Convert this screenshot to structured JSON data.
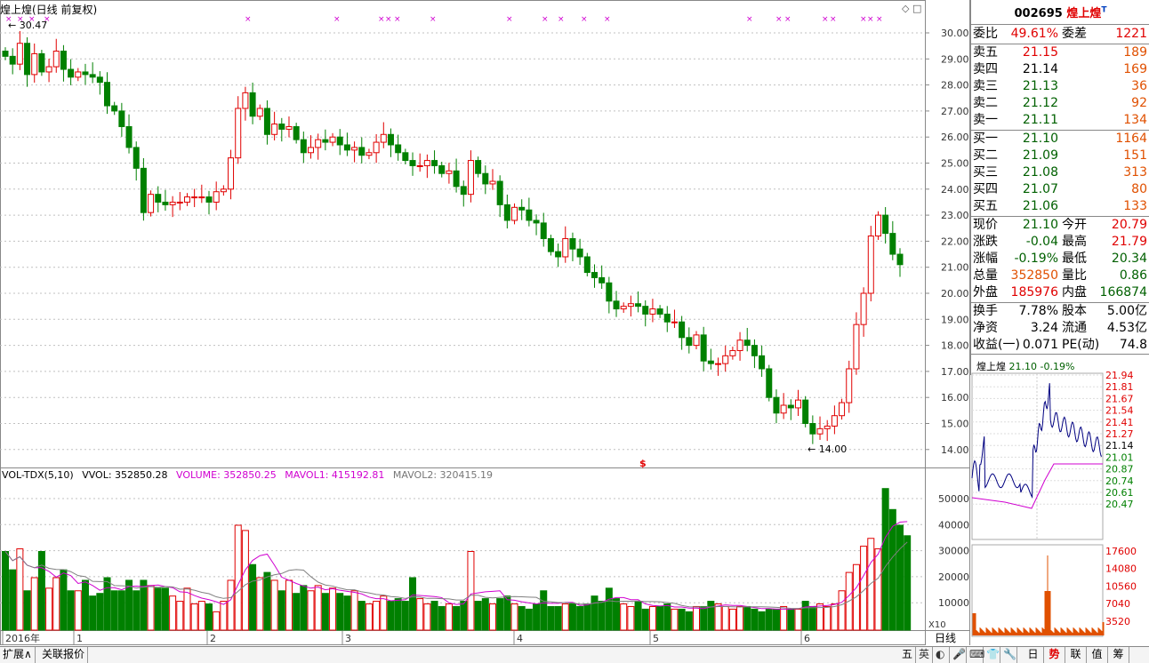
{
  "header": {
    "title": "煌上煌(日线 前复权)",
    "ctrl_icon": "◇",
    "close_icon": "□"
  },
  "price_chart": {
    "high_label": "30.47",
    "low_label": "14.00",
    "special_mark": "$",
    "xmarks": "×",
    "y_ticks": [
      "30.00",
      "29.00",
      "28.00",
      "27.00",
      "26.00",
      "25.00",
      "24.00",
      "23.00",
      "22.00",
      "21.00",
      "20.00",
      "19.00",
      "18.00",
      "17.00",
      "16.00",
      "15.00",
      "14.00"
    ]
  },
  "vol_chart": {
    "legend": {
      "name": "VOL-TDX(5,10)",
      "vvol": "VVOL: 352850.28",
      "volume": "VOLUME: 352850.25",
      "mavol1": "MAVOL1: 415192.81",
      "mavol2": "MAVOL2: 320415.19"
    },
    "y_ticks": [
      "50000",
      "40000",
      "30000",
      "20000",
      "10000"
    ],
    "unit": "X10"
  },
  "x_axis": {
    "labels": [
      "2016年",
      "1",
      "2",
      "3",
      "4",
      "5",
      "6"
    ]
  },
  "period_label": "日线",
  "bottom_buttons": [
    "扩展∧",
    "关联报价"
  ],
  "bottom_icons": [
    "五",
    "英",
    "◐",
    "🎤",
    "⌨",
    "👕",
    "🔧"
  ],
  "right_tabs": [
    "日",
    "势",
    "联",
    "值",
    "筹"
  ],
  "quote": {
    "code": "002695",
    "name": "煌上煌",
    "flag": "T",
    "weibi": {
      "label": "委比",
      "value": "49.61%",
      "label2": "委差",
      "value2": "1221"
    },
    "sell": [
      {
        "label": "卖五",
        "price": "21.15",
        "vol": "189"
      },
      {
        "label": "卖四",
        "price": "21.14",
        "vol": "169"
      },
      {
        "label": "卖三",
        "price": "21.13",
        "vol": "36"
      },
      {
        "label": "卖二",
        "price": "21.12",
        "vol": "92"
      },
      {
        "label": "卖一",
        "price": "21.11",
        "vol": "134"
      }
    ],
    "buy": [
      {
        "label": "买一",
        "price": "21.10",
        "vol": "1164"
      },
      {
        "label": "买二",
        "price": "21.09",
        "vol": "151"
      },
      {
        "label": "买三",
        "price": "21.08",
        "vol": "313"
      },
      {
        "label": "买四",
        "price": "21.07",
        "vol": "80"
      },
      {
        "label": "买五",
        "price": "21.06",
        "vol": "133"
      }
    ],
    "stats": [
      {
        "l1": "现价",
        "v1": "21.10",
        "l2": "今开",
        "v2": "20.79"
      },
      {
        "l1": "涨跌",
        "v1": "-0.04",
        "l2": "最高",
        "v2": "21.79"
      },
      {
        "l1": "涨幅",
        "v1": "-0.19%",
        "l2": "最低",
        "v2": "20.34"
      },
      {
        "l1": "总量",
        "v1": "352850",
        "l2": "量比",
        "v2": "0.86"
      },
      {
        "l1": "外盘",
        "v1": "185976",
        "l2": "内盘",
        "v2": "166874"
      }
    ],
    "stats2": [
      {
        "l1": "换手",
        "v1": "7.78%",
        "l2": "股本",
        "v2": "5.00亿"
      },
      {
        "l1": "净资",
        "v1": "3.24",
        "l2": "流通",
        "v2": "4.53亿"
      },
      {
        "l1": "收益(一)",
        "v1": "0.071",
        "l2": "PE(动)",
        "v2": "74.8"
      }
    ]
  },
  "mini_chart": {
    "name": "煌上煌",
    "price": "21.10",
    "pct": "-0.19%",
    "y_ticks": [
      "21.94",
      "21.81",
      "21.67",
      "21.54",
      "21.41",
      "21.27",
      "21.14",
      "21.01",
      "20.87",
      "20.74",
      "20.61",
      "20.47"
    ],
    "vol_ticks": [
      "17600",
      "14080",
      "10560",
      "7040",
      "3520"
    ]
  },
  "colors": {
    "up": "#e00000",
    "down": "#008000",
    "ma1": "#d000d0",
    "ma2": "#808080"
  }
}
